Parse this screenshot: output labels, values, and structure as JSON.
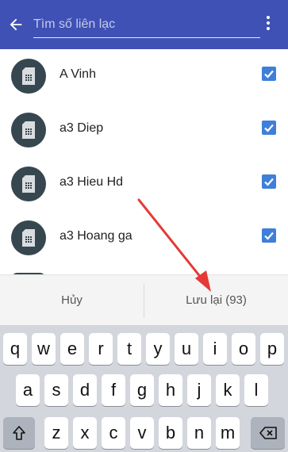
{
  "search": {
    "placeholder": "Tìm số liên lạc",
    "back_icon": "arrow-left-icon",
    "menu_icon": "more-vert-icon"
  },
  "contacts": [
    {
      "name": "A Vinh",
      "checked": true,
      "icon": "sim-card-icon"
    },
    {
      "name": "a3 Diep",
      "checked": true,
      "icon": "sim-card-icon"
    },
    {
      "name": "a3 Hieu Hd",
      "checked": true,
      "icon": "sim-card-icon"
    },
    {
      "name": "a3 Hoang ga",
      "checked": true,
      "icon": "sim-card-icon"
    }
  ],
  "actions": {
    "cancel_label": "Hủy",
    "save_label": "Lưu lại (93)"
  },
  "keyboard": {
    "row1": [
      "q",
      "w",
      "e",
      "r",
      "t",
      "y",
      "u",
      "i",
      "o",
      "p"
    ],
    "row2": [
      "a",
      "s",
      "d",
      "f",
      "g",
      "h",
      "j",
      "k",
      "l"
    ],
    "row3": [
      "z",
      "x",
      "c",
      "v",
      "b",
      "n",
      "m"
    ],
    "shift_icon": "shift-icon",
    "backspace_icon": "backspace-icon"
  },
  "colors": {
    "appbar": "#3f51b5",
    "avatar": "#37474f",
    "checkbox": "#3f7fd9",
    "annotation_arrow": "#e53935"
  }
}
